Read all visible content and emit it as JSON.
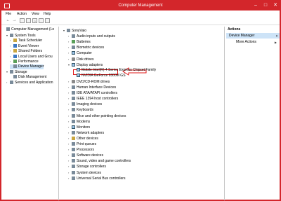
{
  "window": {
    "title": "Computer Management"
  },
  "menu": [
    "File",
    "Action",
    "View",
    "Help"
  ],
  "left_tree": [
    {
      "label": "Computer Management (Lo",
      "level": 0,
      "exp": "",
      "icon": "computer",
      "color": "gray"
    },
    {
      "label": "System Tools",
      "level": 1,
      "exp": "▾",
      "icon": "tools",
      "color": "gray"
    },
    {
      "label": "Task Scheduler",
      "level": 2,
      "exp": "›",
      "icon": "clock",
      "color": "yellow"
    },
    {
      "label": "Event Viewer",
      "level": 2,
      "exp": "›",
      "icon": "log",
      "color": "blue"
    },
    {
      "label": "Shared Folders",
      "level": 2,
      "exp": "›",
      "icon": "folder",
      "color": "yellow"
    },
    {
      "label": "Local Users and Grou",
      "level": 2,
      "exp": "›",
      "icon": "users",
      "color": "blue"
    },
    {
      "label": "Performance",
      "level": 2,
      "exp": "›",
      "icon": "performance",
      "color": "green"
    },
    {
      "label": "Device Manager",
      "level": 2,
      "exp": "",
      "icon": "device",
      "color": "gray",
      "selected": true
    },
    {
      "label": "Storage",
      "level": 1,
      "exp": "▾",
      "icon": "storage",
      "color": "gray"
    },
    {
      "label": "Disk Management",
      "level": 2,
      "exp": "",
      "icon": "disk",
      "color": "gray"
    },
    {
      "label": "Services and Application",
      "level": 1,
      "exp": "›",
      "icon": "services",
      "color": "gray"
    }
  ],
  "device_tree": [
    {
      "label": "SonyVaio",
      "level": 0,
      "exp": "▾",
      "color": "gray"
    },
    {
      "label": "Audio inputs and outputs",
      "level": 1,
      "exp": "›",
      "color": "gray"
    },
    {
      "label": "Batteries",
      "level": 1,
      "exp": "›",
      "color": "green"
    },
    {
      "label": "Biometric devices",
      "level": 1,
      "exp": "›",
      "color": "gray"
    },
    {
      "label": "Computer",
      "level": 1,
      "exp": "›",
      "color": "monitor"
    },
    {
      "label": "Disk drives",
      "level": 1,
      "exp": "›",
      "color": "disk"
    },
    {
      "label": "Display adapters",
      "level": 1,
      "exp": "▾",
      "color": "monitor"
    },
    {
      "label": "Mobile Intel(R) 4 Series Express Chipset Family",
      "level": 2,
      "exp": "",
      "color": "monitor"
    },
    {
      "label": "NVIDIA GeForce 9300M GS",
      "level": 2,
      "exp": "",
      "color": "monitor",
      "highlight": true
    },
    {
      "label": "DVD/CD-ROM drives",
      "level": 1,
      "exp": "›",
      "color": "disk"
    },
    {
      "label": "Human Interface Devices",
      "level": 1,
      "exp": "›",
      "color": "gray"
    },
    {
      "label": "IDE ATA/ATAPI controllers",
      "level": 1,
      "exp": "›",
      "color": "gray"
    },
    {
      "label": "IEEE 1394 host controllers",
      "level": 1,
      "exp": "›",
      "color": "gray"
    },
    {
      "label": "Imaging devices",
      "level": 1,
      "exp": "›",
      "color": "gray"
    },
    {
      "label": "Keyboards",
      "level": 1,
      "exp": "›",
      "color": "gray"
    },
    {
      "label": "Mice and other pointing devices",
      "level": 1,
      "exp": "›",
      "color": "gray"
    },
    {
      "label": "Modems",
      "level": 1,
      "exp": "›",
      "color": "gray"
    },
    {
      "label": "Monitors",
      "level": 1,
      "exp": "›",
      "color": "monitor"
    },
    {
      "label": "Network adapters",
      "level": 1,
      "exp": "›",
      "color": "gray"
    },
    {
      "label": "Other devices",
      "level": 1,
      "exp": "›",
      "color": "yellow"
    },
    {
      "label": "Print queues",
      "level": 1,
      "exp": "›",
      "color": "gray"
    },
    {
      "label": "Processors",
      "level": 1,
      "exp": "›",
      "color": "gray"
    },
    {
      "label": "Software devices",
      "level": 1,
      "exp": "›",
      "color": "gray"
    },
    {
      "label": "Sound, video and game controllers",
      "level": 1,
      "exp": "›",
      "color": "gray"
    },
    {
      "label": "Storage controllers",
      "level": 1,
      "exp": "›",
      "color": "gray"
    },
    {
      "label": "System devices",
      "level": 1,
      "exp": "›",
      "color": "gray"
    },
    {
      "label": "Universal Serial Bus controllers",
      "level": 1,
      "exp": "›",
      "color": "gray"
    }
  ],
  "actions": {
    "title": "Actions",
    "selected": "Device Manager",
    "items": [
      "More Actions"
    ]
  },
  "colors": {
    "accent": "#d3262b",
    "highlight": "#e01919",
    "selection": "#cde3f7"
  }
}
